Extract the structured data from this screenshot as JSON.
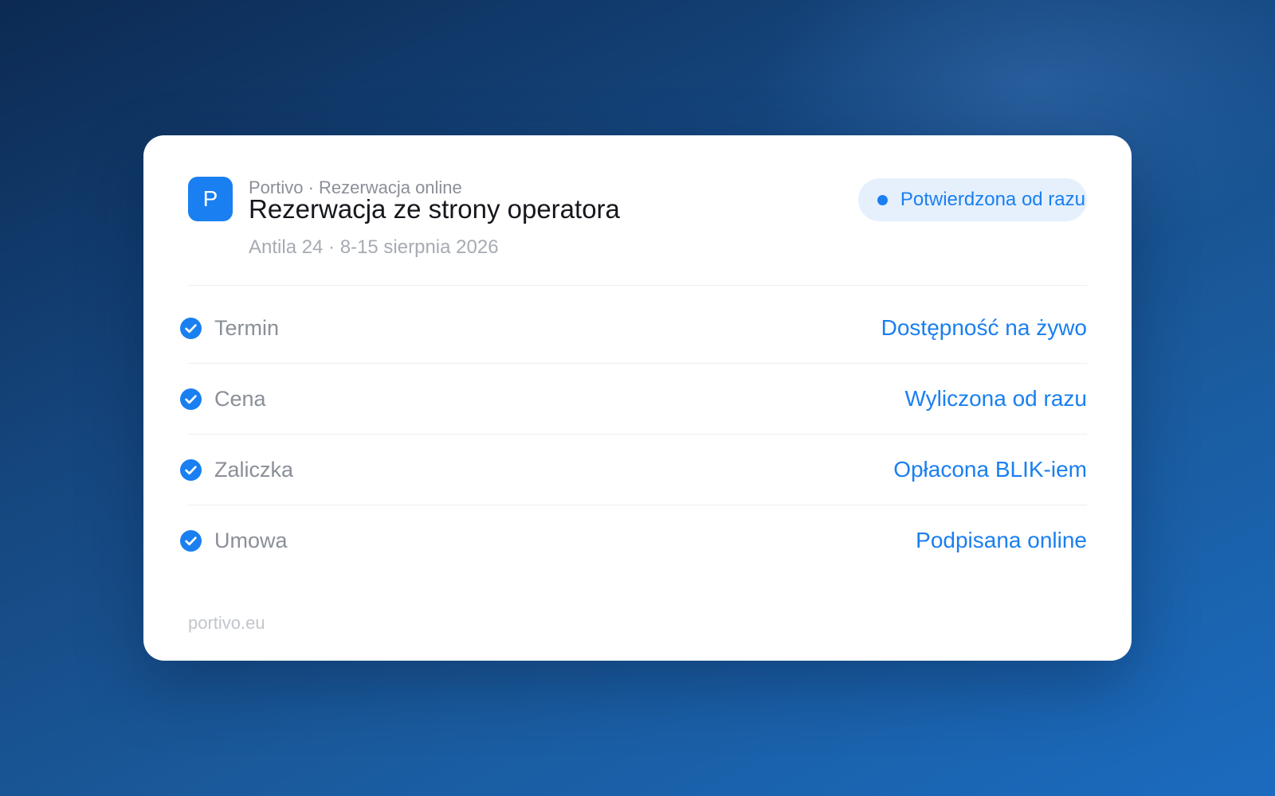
{
  "app": {
    "logo_letter": "P",
    "eyebrow": "Portivo · Rezerwacja online",
    "title": "Rezerwacja ze strony operatora",
    "subtitle": "Antila 24 · 8-15 sierpnia 2026"
  },
  "status_badge": {
    "label": "Potwierdzona od razu",
    "color": "#1a7ff0",
    "background": "#e5f0fc"
  },
  "steps": [
    {
      "label": "Termin",
      "value": "Dostępność na żywo",
      "icon": "check-circle-icon"
    },
    {
      "label": "Cena",
      "value": "Wyliczona od razu",
      "icon": "check-circle-icon"
    },
    {
      "label": "Zaliczka",
      "value": "Opłacona BLIK-iem",
      "icon": "check-circle-icon"
    },
    {
      "label": "Umowa",
      "value": "Podpisana online",
      "icon": "check-circle-icon"
    }
  ],
  "footer": {
    "domain": "portivo.eu"
  },
  "colors": {
    "accent": "#1a7ff0",
    "muted_text": "#8a8f98",
    "title_text": "#15171c"
  }
}
